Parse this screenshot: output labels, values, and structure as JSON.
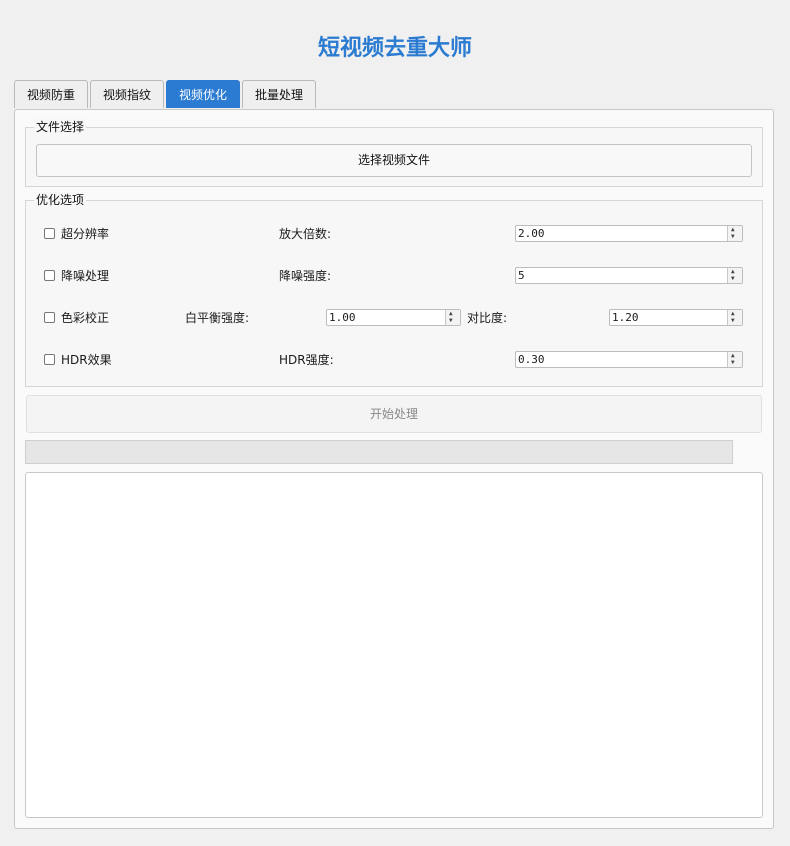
{
  "app": {
    "title": "短视频去重大师"
  },
  "tabs": [
    "视频防重",
    "视频指纹",
    "视频优化",
    "批量处理"
  ],
  "file_section": {
    "title": "文件选择",
    "select_button": "选择视频文件"
  },
  "options": {
    "title": "优化选项",
    "super_resolution": {
      "label": "超分辨率",
      "checked": false,
      "param_label": "放大倍数:",
      "value": "2.00"
    },
    "denoise": {
      "label": "降噪处理",
      "checked": false,
      "param_label": "降噪强度:",
      "value": "5"
    },
    "color_correction": {
      "label": "色彩校正",
      "checked": false,
      "wb_label": "白平衡强度:",
      "wb_value": "1.00",
      "contrast_label": "对比度:",
      "contrast_value": "1.20"
    },
    "hdr": {
      "label": "HDR效果",
      "checked": false,
      "param_label": "HDR强度:",
      "value": "0.30"
    }
  },
  "start_button": "开始处理",
  "progress": {
    "value": 0
  },
  "log": {
    "text": ""
  },
  "colors": {
    "accent": "#2a7bd1",
    "background": "#f0f0f0"
  }
}
